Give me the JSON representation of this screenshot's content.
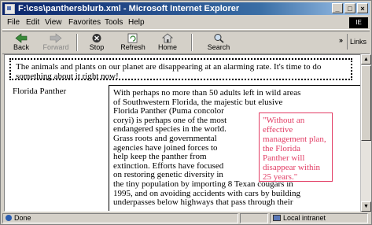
{
  "window": {
    "title": "F:\\css\\panthersblurb.xml - Microsoft Internet Explorer",
    "controls": [
      "_",
      "□",
      "×"
    ]
  },
  "menu": {
    "items": [
      "File",
      "Edit",
      "View",
      "Favorites",
      "Tools",
      "Help"
    ],
    "brand": "IE"
  },
  "toolbar": {
    "back": "Back",
    "forward": "Forward",
    "stop": "Stop",
    "refresh": "Refresh",
    "home": "Home",
    "search": "Search",
    "chevron": "»",
    "links": "Links"
  },
  "page": {
    "intro": "The animals and plants on our planet are disappearing at an alarming rate. It's time to do something about it right now!",
    "side_heading": "Florida Panther",
    "article_lines": [
      "With perhaps no more than 50 adults left in wild areas",
      "of Southwestern Florida, the majestic but elusive",
      "Florida Panther (Puma concolor",
      "coryi) is perhaps one of the most",
      "endangered species in the world.",
      "Grass roots and governmental",
      "agencies have joined forces to",
      "help keep the panther from",
      "extinction. Efforts have focused",
      "on restoring genetic diversity in",
      "the tiny population by importing 8 Texan cougars in",
      "1995, and on avoiding accidents with cars by building",
      "underpasses below highways that pass through their"
    ],
    "quote_lines": [
      "\"Without an",
      "effective",
      "management plan,",
      "the Florida",
      "Panther will",
      "disappear within",
      "25 years.\""
    ]
  },
  "status": {
    "left": "Done",
    "zone": "Local intranet"
  },
  "colors": {
    "titlebar": "#0a246a",
    "quote": "#e23c64",
    "chrome": "#d4d0c8"
  }
}
